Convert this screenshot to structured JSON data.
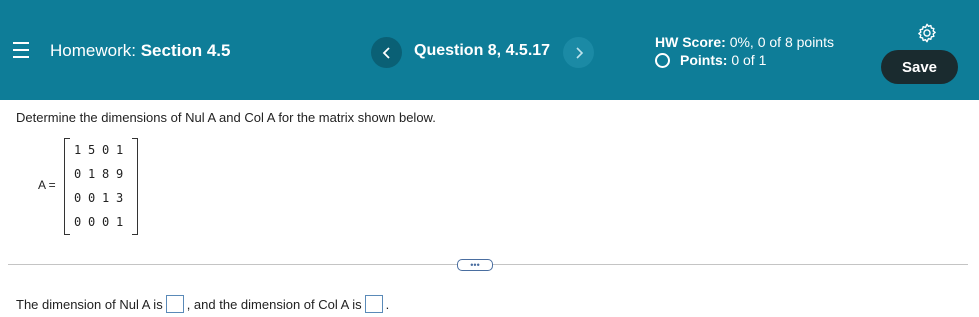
{
  "header": {
    "homework_prefix": "Homework:",
    "homework_section": "Section 4.5",
    "question_label": "Question 8, 4.5.17",
    "hw_score_label": "HW Score:",
    "hw_score_value": "0%, 0 of 8 points",
    "points_label": "Points:",
    "points_value": "0 of 1",
    "save_label": "Save",
    "background_color": "#0e7d98"
  },
  "question": {
    "prompt": "Determine the dimensions of Nul A and Col A for the matrix shown below.",
    "matrix_label": "A =",
    "matrix": [
      [
        "1",
        "5",
        "0",
        "1"
      ],
      [
        "0",
        "1",
        "8",
        "9"
      ],
      [
        "0",
        "0",
        "1",
        "3"
      ],
      [
        "0",
        "0",
        "0",
        "1"
      ]
    ]
  },
  "answer": {
    "part1": "The dimension of Nul A is",
    "part2": ", and the dimension of Col A is",
    "part3": "."
  },
  "more_button": "•••"
}
